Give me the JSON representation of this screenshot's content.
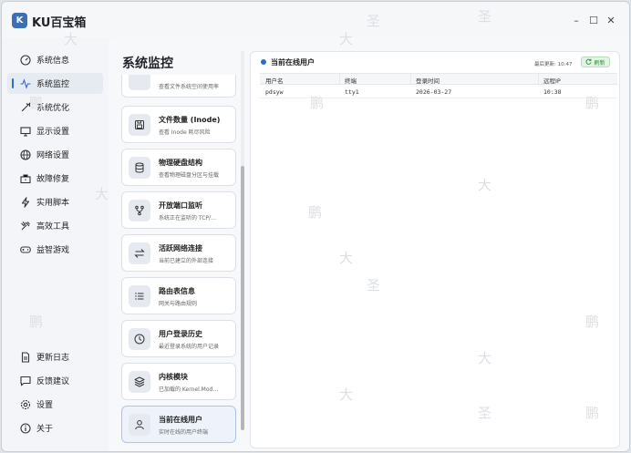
{
  "app": {
    "icon_letter": "K",
    "title": "KU百宝箱"
  },
  "window_controls": {
    "minimize": "–",
    "maximize": "☐",
    "close": "✕"
  },
  "sidebar": {
    "items": [
      {
        "label": "系统信息",
        "icon": "gauge-icon",
        "active": false
      },
      {
        "label": "系统监控",
        "icon": "pulse-icon",
        "active": true
      },
      {
        "label": "系统优化",
        "icon": "rocket-icon",
        "active": false
      },
      {
        "label": "显示设置",
        "icon": "monitor-icon",
        "active": false
      },
      {
        "label": "网络设置",
        "icon": "globe-icon",
        "active": false
      },
      {
        "label": "故障修复",
        "icon": "toolbox-icon",
        "active": false
      },
      {
        "label": "实用脚本",
        "icon": "lightning-icon",
        "active": false
      },
      {
        "label": "高效工具",
        "icon": "tools-icon",
        "active": false
      },
      {
        "label": "益智游戏",
        "icon": "gamepad-icon",
        "active": false
      }
    ],
    "bottom_items": [
      {
        "label": "更新日志",
        "icon": "document-icon"
      },
      {
        "label": "反馈建议",
        "icon": "chat-icon"
      },
      {
        "label": "设置",
        "icon": "gear-icon"
      },
      {
        "label": "关于",
        "icon": "info-icon"
      }
    ]
  },
  "main": {
    "title": "系统监控",
    "cards": [
      {
        "title": "",
        "subtitle": "查看文件系统空间使用率",
        "icon": "disk-icon"
      },
      {
        "title": "文件数量 (Inode)",
        "subtitle": "查看 Inode 耗尽风险",
        "icon": "save-icon"
      },
      {
        "title": "物理硬盘结构",
        "subtitle": "查看物理磁盘分区与挂载",
        "icon": "database-icon"
      },
      {
        "title": "开放端口监听",
        "subtitle": "系统正在监听的 TCP/…",
        "icon": "branch-icon"
      },
      {
        "title": "活跃网络连接",
        "subtitle": "当前已建立的外部连接",
        "icon": "swap-icon"
      },
      {
        "title": "路由表信息",
        "subtitle": "网关与路由规则",
        "icon": "list-icon"
      },
      {
        "title": "用户登录历史",
        "subtitle": "最近登录系统的用户记录",
        "icon": "clock-icon"
      },
      {
        "title": "内核模块",
        "subtitle": "已加载的 Kernel.Mod…",
        "icon": "layers-icon"
      },
      {
        "title": "当前在线用户",
        "subtitle": "实时在线的用户终端",
        "icon": "user-icon",
        "active": true
      }
    ]
  },
  "panel": {
    "title": "当前在线用户",
    "last_update_label": "最后更新: 10:47",
    "refresh_label": "刷新",
    "columns": [
      "用户名",
      "终端",
      "登录时间",
      "远程IP"
    ],
    "rows": [
      [
        "pdsyw",
        "tty1",
        "2026-03-27",
        "10:38"
      ]
    ]
  },
  "watermark": {
    "chars": [
      "鹏",
      "大",
      "圣"
    ]
  },
  "colors": {
    "accent": "#2e6cd1",
    "refresh_green": "#2e8b3a"
  }
}
